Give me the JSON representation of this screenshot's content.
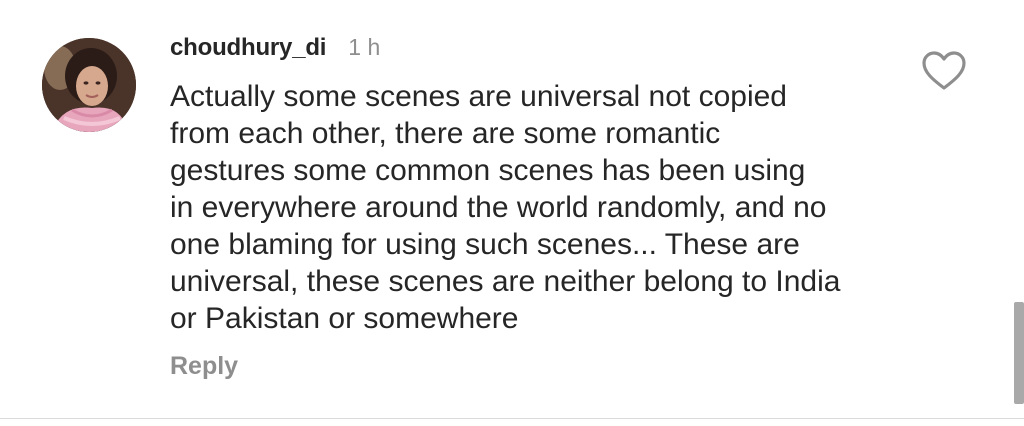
{
  "comment": {
    "username": "choudhury_di",
    "time": "1 h",
    "text": "Actually some scenes are universal not copied\nfrom each other,  there are some romantic\ngestures some common scenes has been using\nin everywhere around the world randomly, and no\none blaming for using such scenes... These are\nuniversal, these scenes are neither belong to India\nor Pakistan or somewhere",
    "reply_label": "Reply",
    "like_icon": "heart-outline-icon"
  },
  "colors": {
    "text": "#262626",
    "muted": "#8e8e8e",
    "scrollbar": "#a9a9a9",
    "divider": "#dbdbdb"
  }
}
